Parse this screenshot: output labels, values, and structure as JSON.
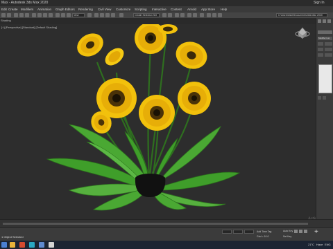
{
  "window": {
    "title": "Max - Autodesk 3ds Max 2020",
    "sign_in": "Sign In"
  },
  "menu": [
    "Edit",
    "Create",
    "Modifiers",
    "Animation",
    "Graph Editors",
    "Rendering",
    "Civil View",
    "Customize",
    "Scripting",
    "Interactive",
    "Content",
    "Arnold",
    "App Store",
    "Help"
  ],
  "toolbar": {
    "selection_filter": "View",
    "named_selection": "Create Selection Set",
    "path": "C:\\Users\\MAX\\Documents\\3ds Max 2020"
  },
  "ribbon": {
    "label": "Shading"
  },
  "viewport": {
    "label": "[+] [Perspective] [Standard] [Default Shading]",
    "watermark_title": "Activate",
    "watermark_sub": "Go to Settings"
  },
  "command_panel": {
    "modifier_list": "Modifier List"
  },
  "status": {
    "selection": "1 Object Selected",
    "grid": "Grid = 10.0",
    "add_time_tag": "Add Time Tag",
    "auto_key": "Auto Key",
    "set_key": "Set Key"
  },
  "taskbar": {
    "temperature": "21°C",
    "weather": "Haze",
    "language": "ENG"
  },
  "colors": {
    "viewport_bg": "#2d2d2d",
    "petal": "#f2c10c",
    "leaf": "#3f9e2a",
    "taskbar": "#1c2433"
  }
}
